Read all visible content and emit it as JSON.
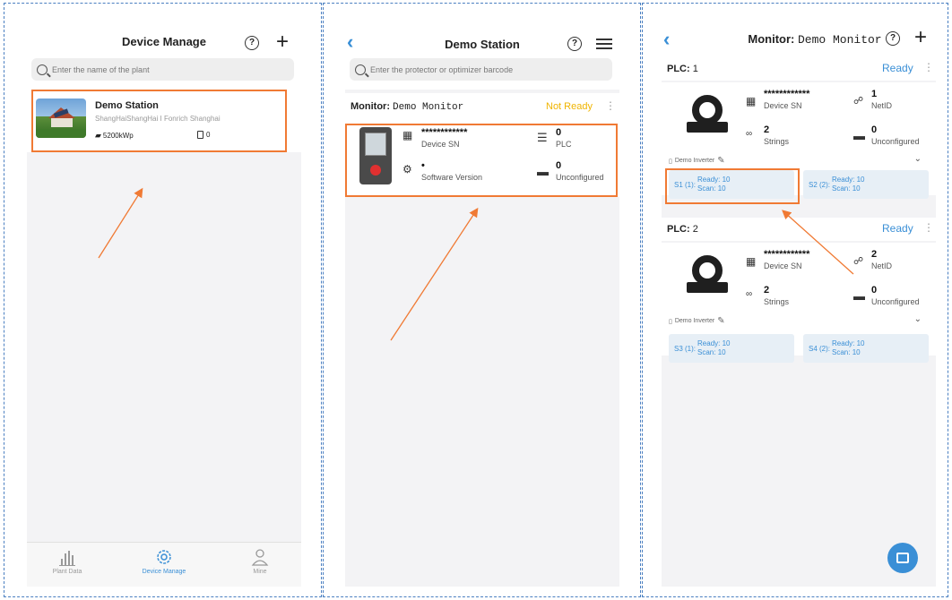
{
  "screen1": {
    "title": "Device Manage",
    "search_placeholder": "Enter the name of the plant",
    "plant": {
      "name": "Demo Station",
      "address": "ShangHaiShangHai I Fonrich Shanghai",
      "capacity": "5200kWp",
      "device_count": "0"
    },
    "tabs": [
      {
        "label": "Plant Data",
        "icon": "bar-chart-icon"
      },
      {
        "label": "Device Manage",
        "icon": "gear-icon"
      },
      {
        "label": "Mine",
        "icon": "user-icon"
      }
    ]
  },
  "screen2": {
    "title": "Demo Station",
    "search_placeholder": "Enter the protector or optimizer barcode",
    "monitor_prefix": "Monitor:",
    "monitor_name": "Demo Monitor",
    "status": "Not Ready",
    "device": {
      "sn_value": "************",
      "sn_label": "Device SN",
      "software_value": "•",
      "software_label": "Software Version",
      "plc_value": "0",
      "plc_label": "PLC",
      "unconfigured_value": "0",
      "unconfigured_label": "Unconfigured"
    }
  },
  "screen3": {
    "title_prefix": "Monitor:",
    "title_name": "Demo Monitor",
    "plcs": [
      {
        "prefix": "PLC:",
        "number": "1",
        "status": "Ready",
        "sn_value": "************",
        "sn_label": "Device SN",
        "netid_value": "1",
        "netid_label": "NetID",
        "strings_value": "2",
        "strings_label": "Strings",
        "unconfigured_value": "0",
        "unconfigured_label": "Unconfigured",
        "inverter_label": "Demo Inverter",
        "strings": [
          {
            "name": "S1 (1):",
            "ready": "Ready: 10",
            "scan": "Scan: 10"
          },
          {
            "name": "S2 (2):",
            "ready": "Ready: 10",
            "scan": "Scan: 10"
          }
        ]
      },
      {
        "prefix": "PLC:",
        "number": "2",
        "status": "Ready",
        "sn_value": "************",
        "sn_label": "Device SN",
        "netid_value": "2",
        "netid_label": "NetID",
        "strings_value": "2",
        "strings_label": "Strings",
        "unconfigured_value": "0",
        "unconfigured_label": "Unconfigured",
        "inverter_label": "Demo Inverter",
        "strings": [
          {
            "name": "S3 (1):",
            "ready": "Ready: 10",
            "scan": "Scan: 10"
          },
          {
            "name": "S4 (2):",
            "ready": "Ready: 10",
            "scan": "Scan: 10"
          }
        ]
      }
    ]
  },
  "colors": {
    "accent": "#3a8fd6",
    "highlight": "#f07a34",
    "not_ready": "#f0b400",
    "ready": "#3a8fd6",
    "frame_border": "#4a7fc1"
  }
}
